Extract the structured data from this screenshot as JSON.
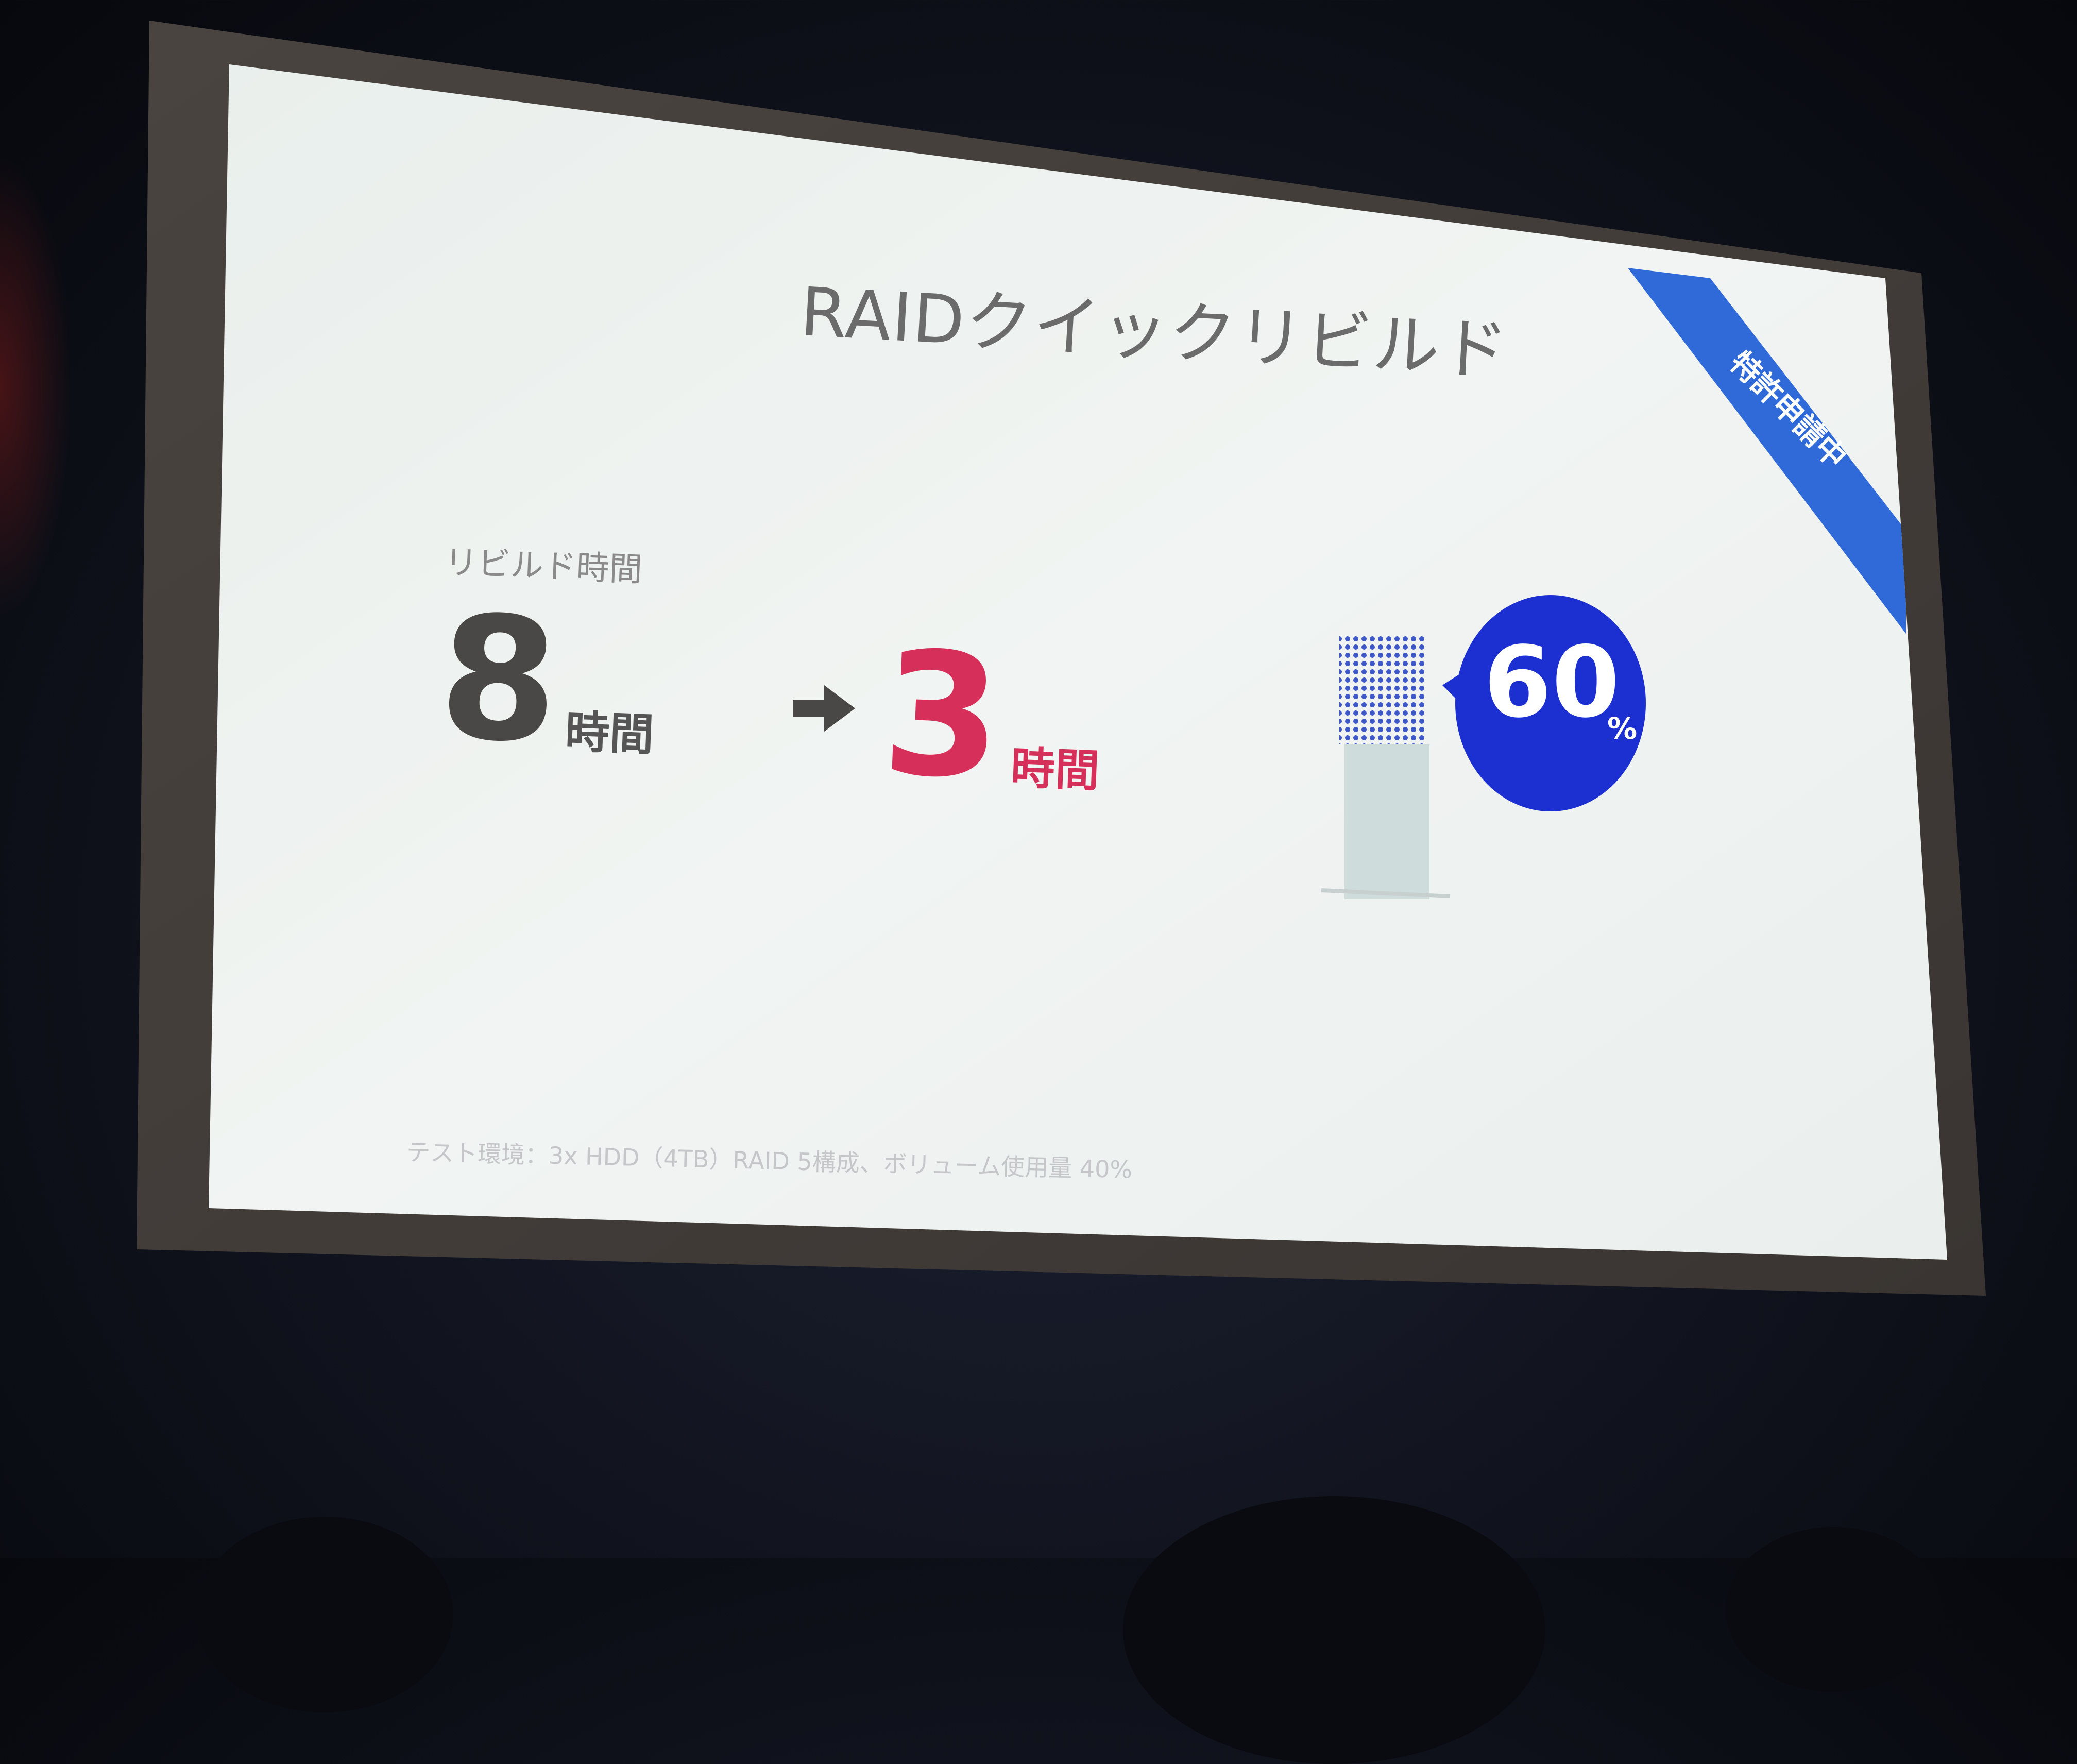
{
  "slide": {
    "title": "RAIDクイックリビルド",
    "patent_badge": "特許申請中",
    "rebuild_time_label": "リビルド時間",
    "before": {
      "value": "8",
      "unit": "時間"
    },
    "after": {
      "value": "3",
      "unit": "時間"
    },
    "reduction": {
      "value": "60",
      "unit": "%"
    },
    "footnote": "テスト環境：3x HDD（4TB）RAID 5構成、ボリューム使用量 40%"
  },
  "colors": {
    "slide_background": "#eef2ef",
    "title_text": "#6b6b6b",
    "before_text": "#4a4846",
    "after_accent": "#d6305a",
    "patent_ribbon": "#2f6ad8",
    "bubble": "#1c2fd0",
    "bar_fill": "#cfdcdc",
    "bar_dots": "#3e57c9"
  },
  "icons": [
    "arrow-right-icon",
    "speech-bubble-icon",
    "patent-ribbon"
  ]
}
